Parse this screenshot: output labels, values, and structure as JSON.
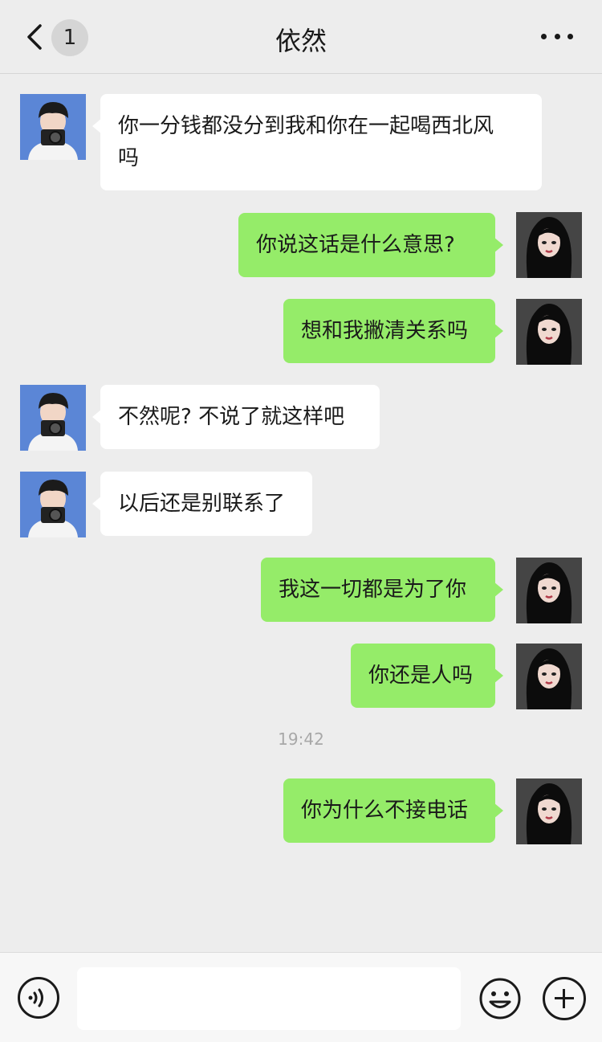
{
  "header": {
    "unread_count": "1",
    "title": "依然"
  },
  "messages": [
    {
      "side": "left",
      "text_lines": [
        "你一分钱都没分到我和你在一起喝西北风",
        "吗"
      ]
    },
    {
      "side": "right",
      "text": "你说这话是什么意思?"
    },
    {
      "side": "right",
      "text": "想和我撇清关系吗"
    },
    {
      "side": "left",
      "text": "不然呢? 不说了就这样吧"
    },
    {
      "side": "left",
      "text": "以后还是别联系了"
    },
    {
      "side": "right",
      "text": "我这一切都是为了你"
    },
    {
      "side": "right",
      "text": "你还是人吗"
    },
    {
      "side": "right",
      "text": "你为什么不接电话"
    }
  ],
  "timestamp": "19:42",
  "input": {
    "placeholder": ""
  },
  "colors": {
    "background": "#ededed",
    "bubble_sent": "#95ec69",
    "bubble_received": "#ffffff",
    "avatar_contact": "#5b86d6",
    "avatar_self": "#454545"
  },
  "icons": {
    "back": "chevron-left-icon",
    "more": "more-dots-icon",
    "voice": "voice-icon",
    "emoji": "emoji-icon",
    "plus": "plus-icon"
  }
}
